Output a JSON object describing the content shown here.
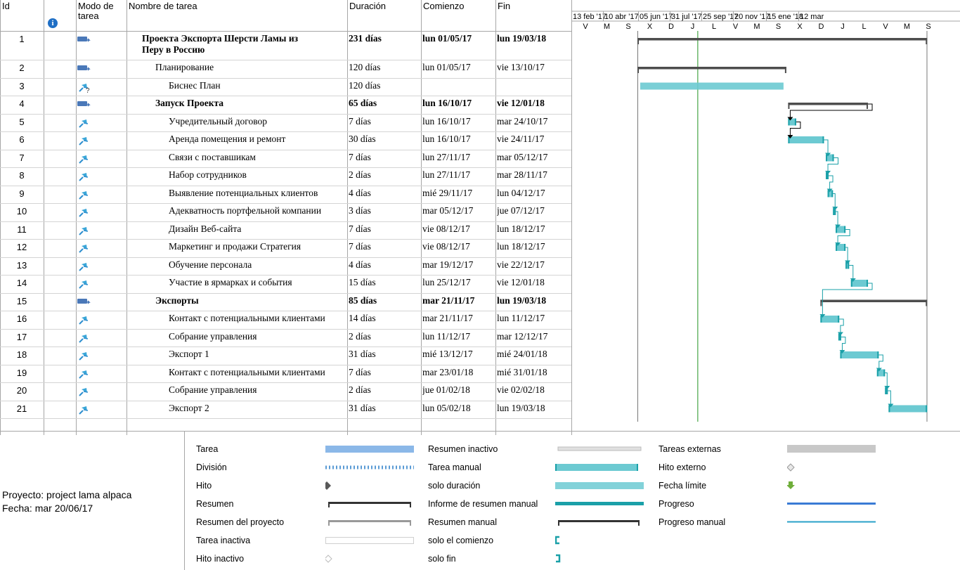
{
  "headers": {
    "id": "Id",
    "mode_line1": "Modo de",
    "mode_line2": "tarea",
    "name": "Nombre de tarea",
    "duration": "Duración",
    "start": "Comienzo",
    "finish": "Fin"
  },
  "timescale": {
    "top": [
      "13 feb '17",
      "10 abr '17",
      "05 jun '17",
      "31 jul '17",
      "25 sep '17",
      "20 nov '17",
      "15 ene '18",
      "12 mar"
    ],
    "bottom": [
      "V",
      "M",
      "S",
      "X",
      "D",
      "J",
      "L",
      "V",
      "M",
      "S",
      "X",
      "D",
      "J",
      "L",
      "V",
      "M",
      "S"
    ]
  },
  "tasks": [
    {
      "id": "1",
      "name": "Проекта Экспорта Шерсти Ламы из",
      "name2": "Перу в Россию",
      "duration": "231 días",
      "start": "lun 01/05/17",
      "finish": "lun 19/03/18",
      "bold": true,
      "indent": 0,
      "mode": "auto"
    },
    {
      "id": "2",
      "name": "Планирование",
      "duration": "120 días",
      "start": "lun 01/05/17",
      "finish": "vie 13/10/17",
      "bold": false,
      "indent": 1,
      "mode": "auto"
    },
    {
      "id": "3",
      "name": "Биснес План",
      "duration": "120 días",
      "start": "",
      "finish": "",
      "bold": false,
      "indent": 2,
      "mode": "manual-q"
    },
    {
      "id": "4",
      "name": "Запуск Проекта",
      "duration": "65 días",
      "start": "lun 16/10/17",
      "finish": "vie 12/01/18",
      "bold": true,
      "indent": 1,
      "mode": "auto"
    },
    {
      "id": "5",
      "name": "Учредительный договор",
      "duration": "7 días",
      "start": "lun 16/10/17",
      "finish": "mar 24/10/17",
      "bold": false,
      "indent": 2,
      "mode": "manual"
    },
    {
      "id": "6",
      "name": "Аренда помещения и ремонт",
      "duration": "30 días",
      "start": "lun 16/10/17",
      "finish": "vie 24/11/17",
      "bold": false,
      "indent": 2,
      "mode": "manual"
    },
    {
      "id": "7",
      "name": "Связи с поставшикам",
      "duration": "7 días",
      "start": "lun 27/11/17",
      "finish": "mar 05/12/17",
      "bold": false,
      "indent": 2,
      "mode": "manual"
    },
    {
      "id": "8",
      "name": "Набор сотрудников",
      "duration": "2 días",
      "start": "lun 27/11/17",
      "finish": "mar 28/11/17",
      "bold": false,
      "indent": 2,
      "mode": "manual"
    },
    {
      "id": "9",
      "name": "Выявление потенциальных клиентов",
      "duration": "4 días",
      "start": "mié 29/11/17",
      "finish": "lun 04/12/17",
      "bold": false,
      "indent": 2,
      "mode": "manual"
    },
    {
      "id": "10",
      "name": "Адекватность портфельной компании",
      "duration": "3 días",
      "start": "mar 05/12/17",
      "finish": "jue 07/12/17",
      "bold": false,
      "indent": 2,
      "mode": "manual"
    },
    {
      "id": "11",
      "name": "Дизайн Веб-сайта",
      "duration": "7 días",
      "start": "vie 08/12/17",
      "finish": "lun 18/12/17",
      "bold": false,
      "indent": 2,
      "mode": "manual"
    },
    {
      "id": "12",
      "name": "Маркетинг и продажи Стратегия",
      "duration": "7 días",
      "start": "vie 08/12/17",
      "finish": "lun 18/12/17",
      "bold": false,
      "indent": 2,
      "mode": "manual"
    },
    {
      "id": "13",
      "name": "Обучение персонала",
      "duration": "4 días",
      "start": "mar 19/12/17",
      "finish": "vie 22/12/17",
      "bold": false,
      "indent": 2,
      "mode": "manual"
    },
    {
      "id": "14",
      "name": "Участие в ярмарках и события",
      "duration": "15 días",
      "start": "lun 25/12/17",
      "finish": "vie 12/01/18",
      "bold": false,
      "indent": 2,
      "mode": "manual"
    },
    {
      "id": "15",
      "name": "Экспорты",
      "duration": "85 días",
      "start": "mar 21/11/17",
      "finish": "lun 19/03/18",
      "bold": true,
      "indent": 1,
      "mode": "auto"
    },
    {
      "id": "16",
      "name": "Контакт с потенциальными клиентами",
      "duration": "14 días",
      "start": "mar 21/11/17",
      "finish": "lun 11/12/17",
      "bold": false,
      "indent": 2,
      "mode": "manual"
    },
    {
      "id": "17",
      "name": "Собрание управления",
      "duration": "2 días",
      "start": "lun 11/12/17",
      "finish": "mar 12/12/17",
      "bold": false,
      "indent": 2,
      "mode": "manual"
    },
    {
      "id": "18",
      "name": "Экспорт 1",
      "duration": "31 días",
      "start": "mié 13/12/17",
      "finish": "mié 24/01/18",
      "bold": false,
      "indent": 2,
      "mode": "manual"
    },
    {
      "id": "19",
      "name": "Контакт с потенциальными клиентами",
      "duration": "7 días",
      "start": "mar 23/01/18",
      "finish": "mié 31/01/18",
      "bold": false,
      "indent": 2,
      "mode": "manual"
    },
    {
      "id": "20",
      "name": "Собрание управления",
      "duration": "2 días",
      "start": "jue 01/02/18",
      "finish": "vie 02/02/18",
      "bold": false,
      "indent": 2,
      "mode": "manual"
    },
    {
      "id": "21",
      "name": "Экспорт 2",
      "duration": "31 días",
      "start": "lun 05/02/18",
      "finish": "lun 19/03/18",
      "bold": false,
      "indent": 2,
      "mode": "manual"
    }
  ],
  "gantt_dates": {
    "axis_start": "2017-02-13",
    "axis_end": "2018-03-19",
    "status_date": "2017-06-20",
    "bars": [
      {
        "id": "1",
        "kind": "summary",
        "start": "2017-05-01",
        "finish": "2018-03-19"
      },
      {
        "id": "2",
        "kind": "summary",
        "start": "2017-05-01",
        "finish": "2017-10-13"
      },
      {
        "id": "3",
        "kind": "duration-only",
        "start": "2017-05-01",
        "finish": "2017-10-13"
      },
      {
        "id": "4",
        "kind": "summary",
        "start": "2017-10-16",
        "finish": "2018-01-12"
      },
      {
        "id": "5",
        "kind": "manual",
        "start": "2017-10-16",
        "finish": "2017-10-24"
      },
      {
        "id": "6",
        "kind": "manual",
        "start": "2017-10-16",
        "finish": "2017-11-24"
      },
      {
        "id": "7",
        "kind": "manual",
        "start": "2017-11-27",
        "finish": "2017-12-05"
      },
      {
        "id": "8",
        "kind": "manual",
        "start": "2017-11-27",
        "finish": "2017-11-28"
      },
      {
        "id": "9",
        "kind": "manual",
        "start": "2017-11-29",
        "finish": "2017-12-04"
      },
      {
        "id": "10",
        "kind": "manual",
        "start": "2017-12-05",
        "finish": "2017-12-07"
      },
      {
        "id": "11",
        "kind": "manual",
        "start": "2017-12-08",
        "finish": "2017-12-18"
      },
      {
        "id": "12",
        "kind": "manual",
        "start": "2017-12-08",
        "finish": "2017-12-18"
      },
      {
        "id": "13",
        "kind": "manual",
        "start": "2017-12-19",
        "finish": "2017-12-22"
      },
      {
        "id": "14",
        "kind": "manual",
        "start": "2017-12-25",
        "finish": "2018-01-12"
      },
      {
        "id": "15",
        "kind": "summary",
        "start": "2017-11-21",
        "finish": "2018-03-19"
      },
      {
        "id": "16",
        "kind": "manual",
        "start": "2017-11-21",
        "finish": "2017-12-11"
      },
      {
        "id": "17",
        "kind": "manual",
        "start": "2017-12-11",
        "finish": "2017-12-12"
      },
      {
        "id": "18",
        "kind": "manual",
        "start": "2017-12-13",
        "finish": "2018-01-24"
      },
      {
        "id": "19",
        "kind": "manual",
        "start": "2018-01-23",
        "finish": "2018-01-31"
      },
      {
        "id": "20",
        "kind": "manual",
        "start": "2018-02-01",
        "finish": "2018-02-02"
      },
      {
        "id": "21",
        "kind": "manual",
        "start": "2018-02-05",
        "finish": "2018-03-19"
      }
    ],
    "links": [
      [
        "4",
        "5"
      ],
      [
        "5",
        "6"
      ],
      [
        "6",
        "7"
      ],
      [
        "7",
        "8"
      ],
      [
        "8",
        "9"
      ],
      [
        "9",
        "10"
      ],
      [
        "10",
        "11"
      ],
      [
        "11",
        "12"
      ],
      [
        "12",
        "13"
      ],
      [
        "13",
        "14"
      ],
      [
        "14",
        "16"
      ],
      [
        "16",
        "17"
      ],
      [
        "17",
        "18"
      ],
      [
        "18",
        "19"
      ],
      [
        "19",
        "20"
      ],
      [
        "20",
        "21"
      ]
    ]
  },
  "legend": {
    "project_label": "Proyecto: project lama alpaca",
    "date_label": "Fecha: mar 20/06/17",
    "col1": [
      "Tarea",
      "División",
      "Hito",
      "Resumen",
      "Resumen del proyecto",
      "Tarea inactiva",
      "Hito inactivo"
    ],
    "col2": [
      "Resumen inactivo",
      "Tarea manual",
      "solo duración",
      "Informe de resumen manual",
      "Resumen manual",
      "solo el comienzo",
      "solo fin"
    ],
    "col3": [
      "Tareas externas",
      "Hito externo",
      "Fecha límite",
      "Progreso",
      "Progreso manual"
    ]
  },
  "colors": {
    "manual_bar": "#6ccad2",
    "manual_edge": "#1aa0a8",
    "summary": "#4d4d4d",
    "link": "#1aa0a8",
    "status_line": "#6bb86a",
    "task_bar": "#8bb8e8",
    "progress": "#3a7bd5"
  },
  "icons": {
    "auto_mode": "auto-scheduled-icon",
    "manual_mode": "manually-scheduled-pin-icon",
    "info": "info-icon"
  }
}
